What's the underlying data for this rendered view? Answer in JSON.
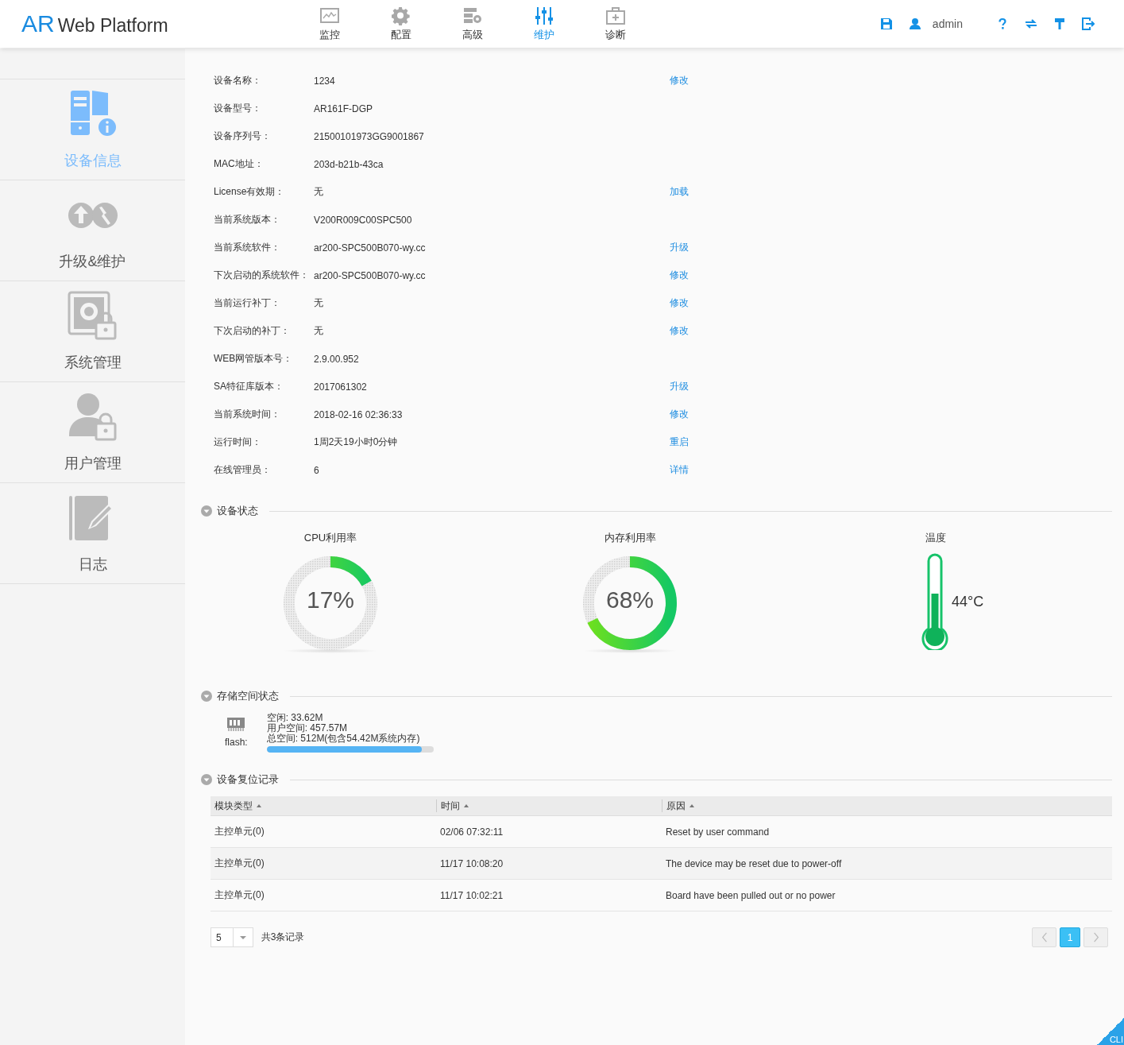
{
  "header": {
    "logo_brand": "AR",
    "logo_name": "Web Platform",
    "nav": [
      {
        "label": "监控",
        "kind": "monitor",
        "selected": false
      },
      {
        "label": "配置",
        "kind": "gear",
        "selected": false
      },
      {
        "label": "高级",
        "kind": "advanced",
        "selected": false
      },
      {
        "label": "维护",
        "kind": "sliders",
        "selected": true
      },
      {
        "label": "诊断",
        "kind": "toolbox",
        "selected": false
      }
    ],
    "user": "admin"
  },
  "sidebar": {
    "items": [
      {
        "label": "设备信息",
        "kind": "device",
        "selected": true
      },
      {
        "label": "升级&维护",
        "kind": "upgrade",
        "selected": false
      },
      {
        "label": "系统管理",
        "kind": "system",
        "selected": false
      },
      {
        "label": "用户管理",
        "kind": "user",
        "selected": false
      },
      {
        "label": "日志",
        "kind": "log",
        "selected": false
      }
    ]
  },
  "device_info": [
    {
      "label": "设备名称：",
      "value": "1234",
      "action": "修改"
    },
    {
      "label": "设备型号：",
      "value": "AR161F-DGP"
    },
    {
      "label": "设备序列号：",
      "value": "21500101973GG9001867"
    },
    {
      "label": "MAC地址：",
      "value": "203d-b21b-43ca"
    },
    {
      "label": "License有效期：",
      "value": "无",
      "action": "加载"
    },
    {
      "label": "当前系统版本：",
      "value": "V200R009C00SPC500"
    },
    {
      "label": "当前系统软件：",
      "value": "ar200-SPC500B070-wy.cc",
      "action": "升级"
    },
    {
      "label": "下次启动的系统软件：",
      "value": "ar200-SPC500B070-wy.cc",
      "action": "修改"
    },
    {
      "label": "当前运行补丁：",
      "value": "无",
      "action": "修改"
    },
    {
      "label": "下次启动的补丁：",
      "value": "无",
      "action": "修改"
    },
    {
      "label": "WEB网管版本号：",
      "value": "2.9.00.952"
    },
    {
      "label": "SA特征库版本：",
      "value": "2017061302",
      "action": "升级"
    },
    {
      "label": "当前系统时间：",
      "value": "2018-02-16 02:36:33",
      "action": "修改"
    },
    {
      "label": "运行时间：",
      "value": "1周2天19小时0分钟",
      "action": "重启"
    },
    {
      "label": "在线管理员：",
      "value": "6",
      "action": "详情"
    }
  ],
  "device_status": {
    "title": "设备状态",
    "expanded": true,
    "cpu": {
      "label": "CPU利用率",
      "level": 0.17,
      "reading": "17%"
    },
    "memory": {
      "label": "内存利用率",
      "level": 0.68,
      "reading": "68%"
    },
    "temperature": {
      "label": "温度",
      "level": 0.5,
      "reading": "44°C"
    }
  },
  "storage": {
    "title": "存储空间状态",
    "expanded": true,
    "device": "flash:",
    "free": "空闲: 33.62M",
    "user_space": "用户空间: 457.57M",
    "total": "总空间: 512M(包含54.42M系统内存)",
    "level": 0.93
  },
  "reset_log": {
    "title": "设备复位记录",
    "expanded": true,
    "columns": [
      "模块类型",
      "时间",
      "原因"
    ],
    "rows": [
      [
        "主控单元(0)",
        "02/06 07:32:11",
        "Reset by user command"
      ],
      [
        "主控单元(0)",
        "11/17 10:08:20",
        "The device may be reset due to power-off"
      ],
      [
        "主控单元(0)",
        "11/17 10:02:21",
        "Board have been pulled out or no power"
      ]
    ],
    "page_size": "5",
    "total": "共3条记录",
    "pages": [
      {
        "label": "1",
        "selected": true
      }
    ]
  },
  "cli": "CLI"
}
